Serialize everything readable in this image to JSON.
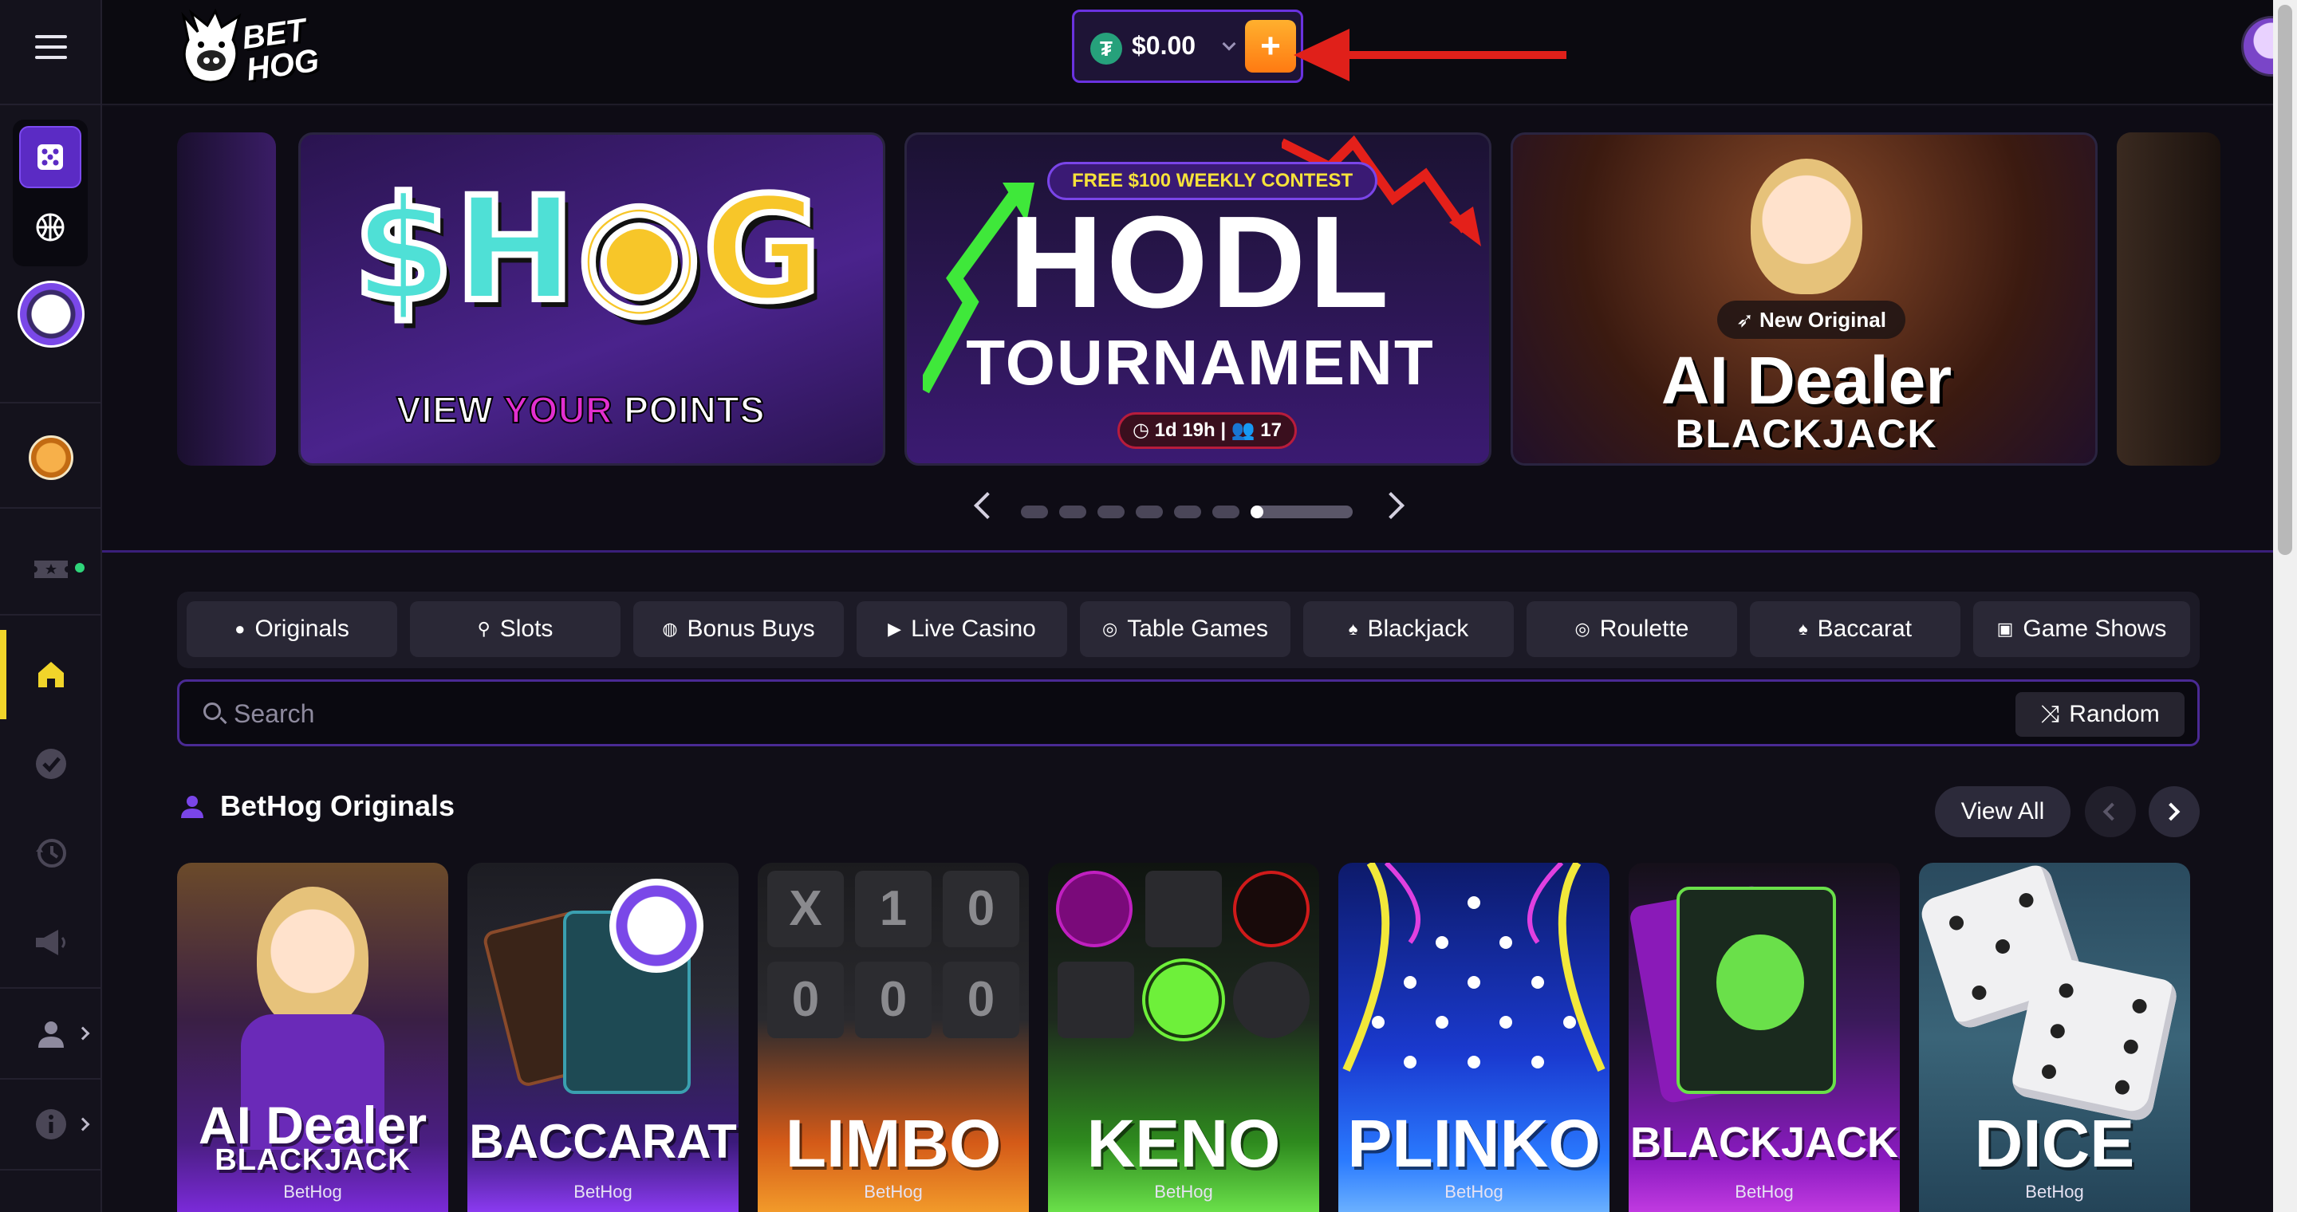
{
  "header": {
    "logo_text": "BET HOG",
    "balance": "$0.00",
    "currency_icon": "tether-icon",
    "deposit_icon": "plus-icon"
  },
  "sidebar": {
    "items": [
      {
        "name": "casino-dice-icon",
        "active": true
      },
      {
        "name": "sports-basketball-icon"
      },
      {
        "name": "hog-points-chip-icon"
      },
      {
        "name": "coin-rewards-icon"
      },
      {
        "name": "tickets-icon"
      },
      {
        "name": "home-icon",
        "active": true
      },
      {
        "name": "verified-badge-icon"
      },
      {
        "name": "history-icon"
      },
      {
        "name": "megaphone-icon"
      },
      {
        "name": "user-icon"
      },
      {
        "name": "info-icon"
      }
    ]
  },
  "banners": {
    "shog": {
      "title_s": "$H",
      "title_g": "G",
      "view": "VIEW",
      "your": "YOUR",
      "points": "POINTS"
    },
    "hodl": {
      "pill": "FREE $100 WEEKLY CONTEST",
      "title": "HODL",
      "subtitle": "TOURNAMENT",
      "timer": "1d 19h",
      "players": "17"
    },
    "dealer": {
      "pill": "New Original",
      "title": "AI Dealer",
      "subtitle": "BLACKJACK"
    }
  },
  "tabs": [
    {
      "label": "Originals",
      "icon": "user-icon"
    },
    {
      "label": "Slots",
      "icon": "joystick-icon"
    },
    {
      "label": "Bonus Buys",
      "icon": "money-bag-icon"
    },
    {
      "label": "Live Casino",
      "icon": "play-icon"
    },
    {
      "label": "Table Games",
      "icon": "target-icon"
    },
    {
      "label": "Blackjack",
      "icon": "cards-icon"
    },
    {
      "label": "Roulette",
      "icon": "roulette-icon"
    },
    {
      "label": "Baccarat",
      "icon": "cards-icon"
    },
    {
      "label": "Game Shows",
      "icon": "tv-icon"
    }
  ],
  "search": {
    "placeholder": "Search",
    "random_label": "Random"
  },
  "section": {
    "title": "BetHog Originals",
    "view_all": "View All"
  },
  "games": [
    {
      "title": "AI Dealer",
      "subtitle": "BLACKJACK",
      "provider": "BetHog"
    },
    {
      "title": "BACCARAT",
      "provider": "BetHog"
    },
    {
      "title": "LIMBO",
      "provider": "BetHog"
    },
    {
      "title": "KENO",
      "provider": "BetHog"
    },
    {
      "title": "PLINKO",
      "provider": "BetHog"
    },
    {
      "title": "BLACKJACK",
      "provider": "BetHog"
    },
    {
      "title": "DICE",
      "provider": "BetHog"
    }
  ],
  "limbo_tiles": [
    "X",
    "1",
    "0",
    "0",
    "0",
    "0"
  ],
  "colors": {
    "accent": "#6a32e0",
    "deposit": "#ff9a1e",
    "active_bar": "#f1d52a",
    "annotation_arrow": "#e0201a"
  }
}
